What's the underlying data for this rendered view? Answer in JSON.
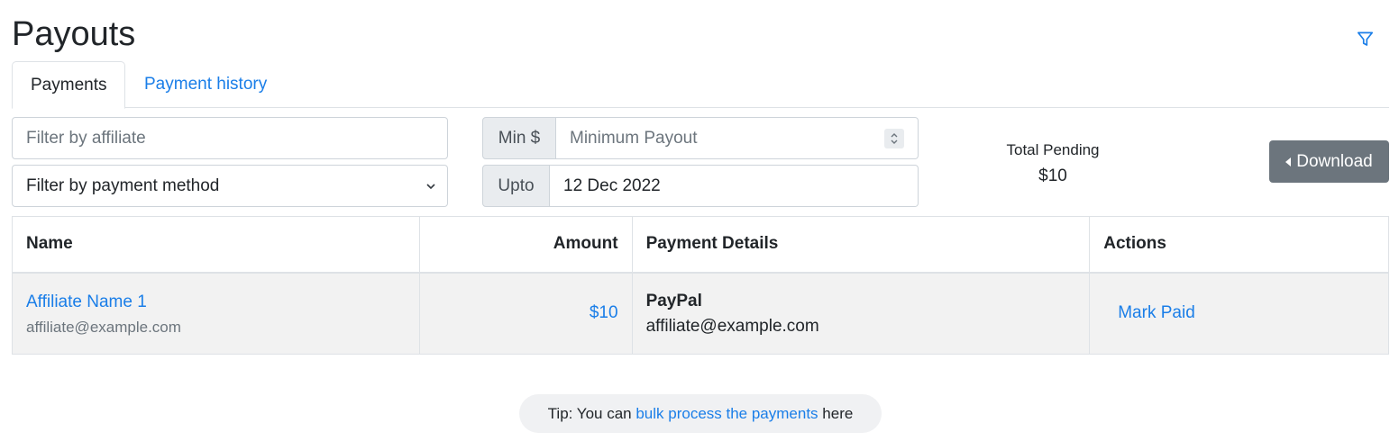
{
  "page": {
    "title": "Payouts"
  },
  "toolbar": {
    "filter_icon": "filter-icon"
  },
  "tabs": [
    {
      "label": "Payments",
      "active": true
    },
    {
      "label": "Payment history",
      "active": false
    }
  ],
  "filters": {
    "affiliate_placeholder": "Filter by affiliate",
    "payment_method_selected": "Filter by payment method",
    "min_prefix": "Min $",
    "min_placeholder": "Minimum Payout",
    "upto_prefix": "Upto",
    "upto_value": "12 Dec 2022"
  },
  "summary": {
    "total_label": "Total Pending",
    "total_value": "$10"
  },
  "download": {
    "label": "Download",
    "icon": "caret-left-icon"
  },
  "table": {
    "headers": {
      "name": "Name",
      "amount": "Amount",
      "details": "Payment Details",
      "actions": "Actions"
    },
    "rows": [
      {
        "name": "Affiliate Name 1",
        "email": "affiliate@example.com",
        "amount": "$10",
        "method": "PayPal",
        "method_detail": "affiliate@example.com",
        "action": "Mark Paid"
      }
    ]
  },
  "tip": {
    "prefix": "Tip: You can ",
    "link": "bulk process the payments",
    "suffix": " here"
  },
  "colors": {
    "link": "#1a7ee8",
    "secondary_button": "#6c757d",
    "row_background": "#f2f2f2"
  }
}
